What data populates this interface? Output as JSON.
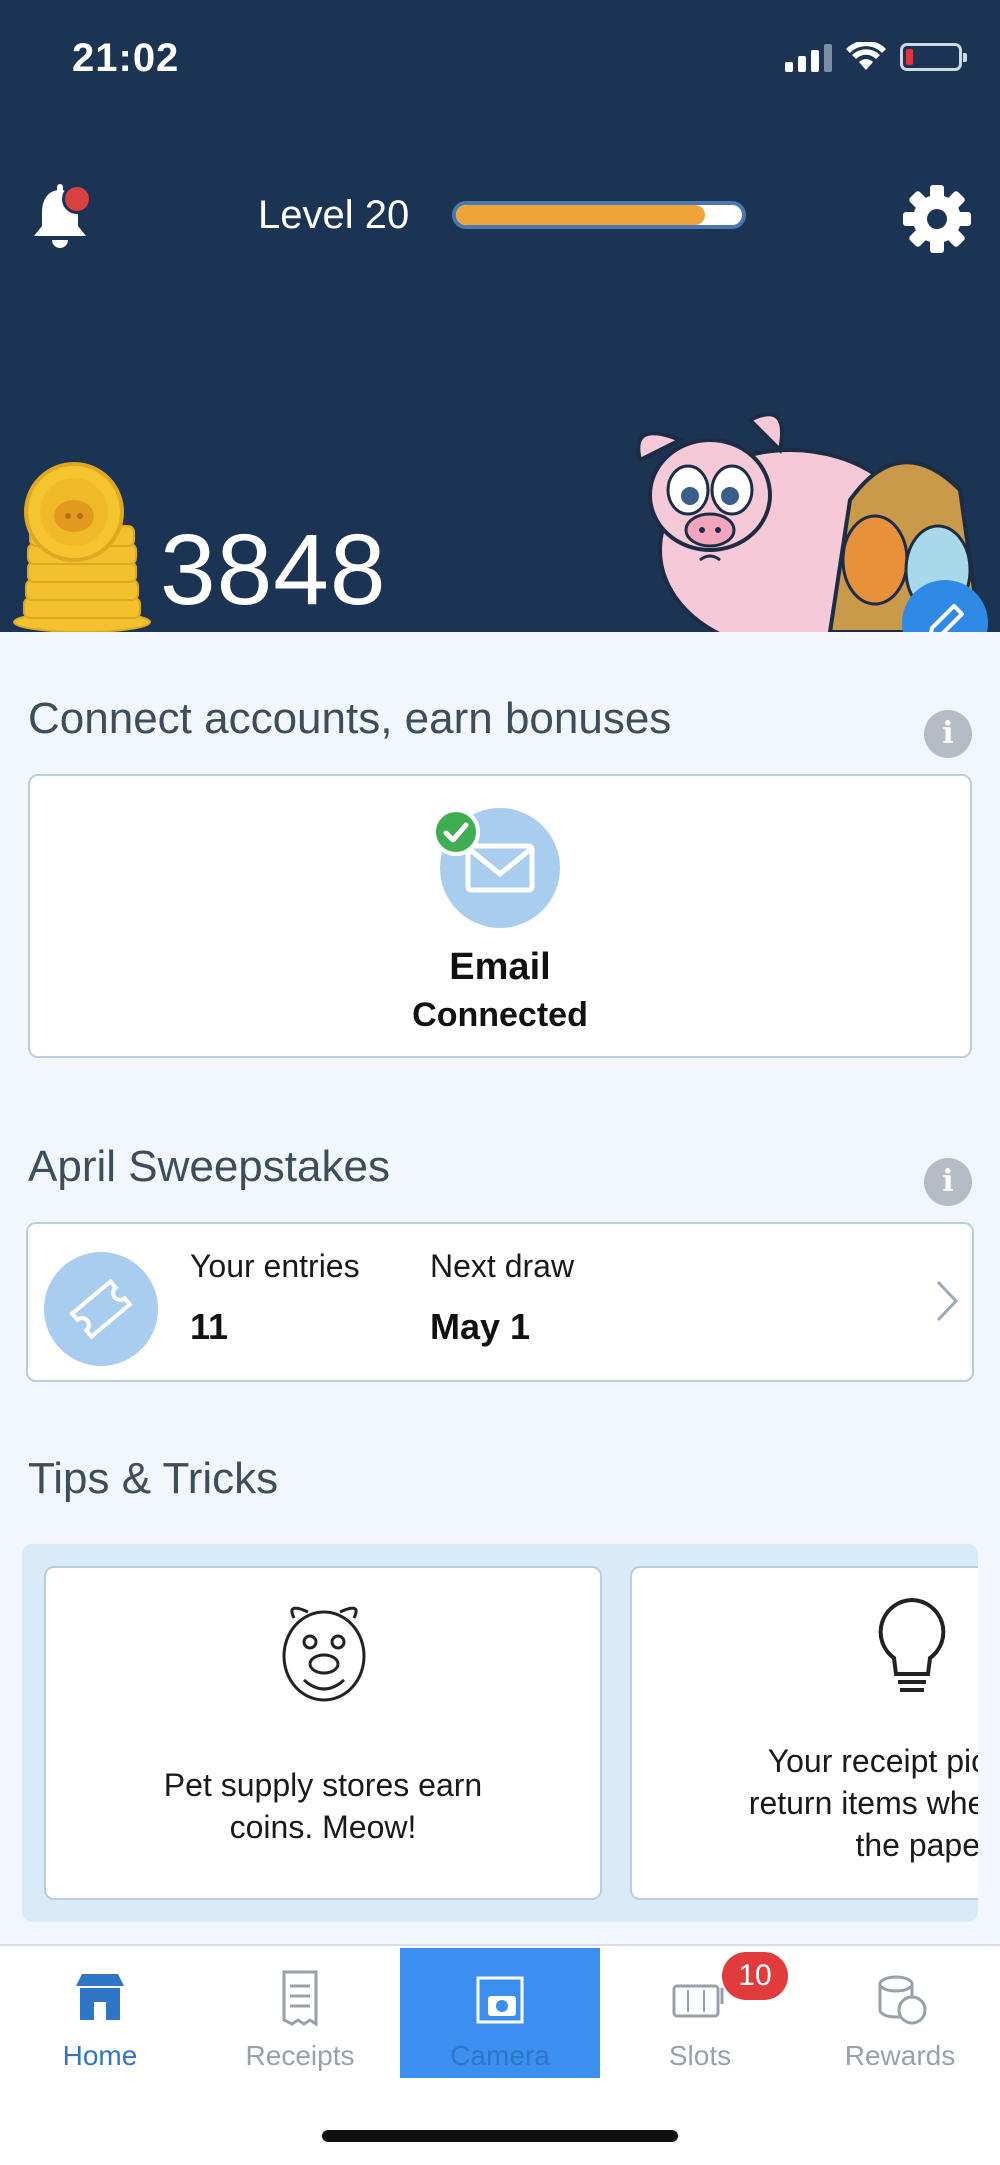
{
  "status_bar": {
    "time": "21:02"
  },
  "header": {
    "level_label": "Level 20",
    "level_progress": 0.87,
    "coin_balance": "3848",
    "colors": {
      "background": "#1c3454",
      "progress": "#efa43a",
      "notification_dot": "#d94040"
    }
  },
  "connect_section": {
    "title": "Connect accounts, earn bonuses",
    "info": "i",
    "email_card": {
      "title": "Email",
      "status": "Connected"
    }
  },
  "sweepstakes": {
    "title": "April Sweepstakes",
    "info": "i",
    "entries_label": "Your entries",
    "entries_value": "11",
    "next_draw_label": "Next draw",
    "next_draw_value": "May 1"
  },
  "tips": {
    "title": "Tips & Tricks",
    "cards": [
      {
        "icon": "pig-face-icon",
        "lines": [
          "Pet supply stores earn",
          "coins. Meow!"
        ]
      },
      {
        "icon": "lightbulb-icon",
        "lines": [
          "Your receipt pics c",
          "return items when y",
          "the paper re"
        ]
      }
    ]
  },
  "tab_bar": {
    "tabs": [
      {
        "label": "Home",
        "icon": "store-icon"
      },
      {
        "label": "Receipts",
        "icon": "receipt-icon"
      },
      {
        "label": "Camera",
        "icon": "camera-icon"
      },
      {
        "label": "Slots",
        "icon": "slot-machine-icon",
        "badge": "10"
      },
      {
        "label": "Rewards",
        "icon": "coins-icon"
      }
    ],
    "active": "Camera",
    "accent": "#3a8ff0"
  }
}
